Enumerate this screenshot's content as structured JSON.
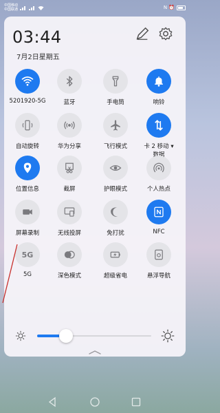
{
  "status_bar": {
    "carrier_1": "中国移动",
    "carrier_2": "中国联通",
    "signal_icons": "signal-wifi-icons",
    "right_icons": "N ⏰",
    "battery_level": 0.75
  },
  "header": {
    "time": "03:44",
    "date": "7月2日星期五"
  },
  "tiles": [
    {
      "label": "5201920-5G",
      "icon": "wifi-icon",
      "state": "on"
    },
    {
      "label": "蓝牙",
      "icon": "bluetooth-icon",
      "state": "off"
    },
    {
      "label": "手电筒",
      "icon": "flashlight-icon",
      "state": "off"
    },
    {
      "label": "响铃",
      "icon": "bell-icon",
      "state": "on"
    },
    {
      "label": "自动旋转",
      "icon": "auto-rotate-icon",
      "state": "off"
    },
    {
      "label": "华为分享",
      "icon": "share-icon",
      "state": "off"
    },
    {
      "label": "飞行模式",
      "icon": "airplane-icon",
      "state": "off"
    },
    {
      "label": "卡 2 移动 ▾",
      "label_line_2": "数据",
      "icon": "mobile-data-icon",
      "state": "on"
    },
    {
      "label": "位置信息",
      "icon": "location-icon",
      "state": "on"
    },
    {
      "label": "截屏",
      "icon": "screenshot-icon",
      "state": "off"
    },
    {
      "label": "护眼模式",
      "icon": "eye-icon",
      "state": "off"
    },
    {
      "label": "个人热点",
      "icon": "hotspot-icon",
      "state": "off"
    },
    {
      "label": "屏幕录制",
      "icon": "screen-record-icon",
      "state": "off"
    },
    {
      "label": "无线投屏",
      "icon": "wireless-projection-icon",
      "state": "off"
    },
    {
      "label": "免打扰",
      "icon": "moon-icon",
      "state": "off"
    },
    {
      "label": "NFC",
      "icon": "nfc-icon",
      "state": "on"
    },
    {
      "label": "5G",
      "icon": "5g-icon",
      "state": "off",
      "icon_text": "5G"
    },
    {
      "label": "深色模式",
      "icon": "dark-mode-icon",
      "state": "off"
    },
    {
      "label": "超级省电",
      "icon": "battery-saver-icon",
      "state": "off"
    },
    {
      "label": "悬浮导航",
      "icon": "floating-nav-icon",
      "state": "off"
    }
  ],
  "brightness": {
    "level": 0.25
  },
  "colors": {
    "accent": "#1e7af0",
    "tile_off": "#e4e4e8"
  }
}
